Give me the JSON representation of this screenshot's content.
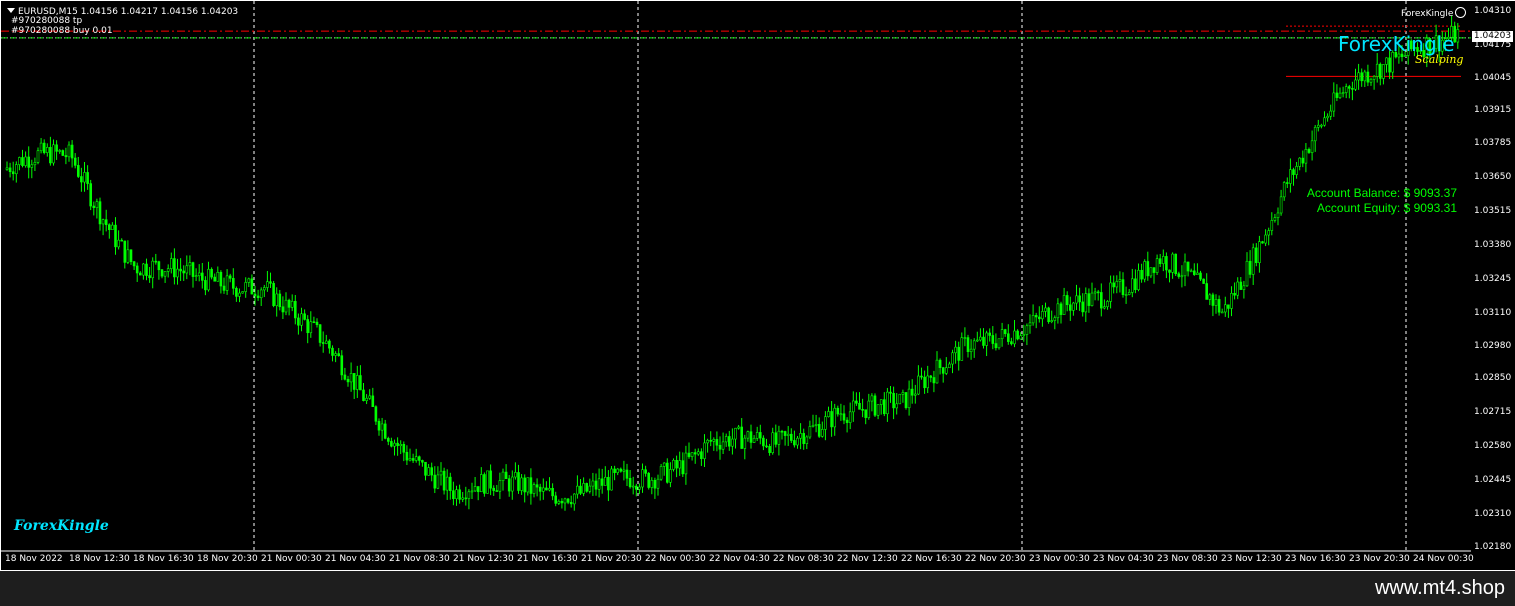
{
  "header": {
    "symbol_line": "EURUSD,M15  1.04156 1.04217 1.04156 1.04203",
    "trade_tp": "#970280088 tp",
    "trade_buy": "#970280088 buy 0.01"
  },
  "indicator": {
    "ea_name": "ForexKingle",
    "brand": "ForexKingle",
    "brand_sub": "Scalping",
    "balance": "Account Balance: $ 9093.37",
    "equity": "Account Equity: $ 9093.31",
    "watermark": "ForexKingle"
  },
  "colors": {
    "background": "#000000",
    "candles": "#00ff00",
    "tp_line": "#ff0000",
    "entry_line": "#00ff00",
    "grid": "#ffffff",
    "brand": "#00e5ff",
    "brand_sub": "#ffff00"
  },
  "price_axis": {
    "labels": [
      "1.04310",
      "1.04175",
      "1.04045",
      "1.03915",
      "1.03785",
      "1.03650",
      "1.03515",
      "1.03380",
      "1.03245",
      "1.03110",
      "1.02980",
      "1.02850",
      "1.02715",
      "1.02580",
      "1.02445",
      "1.02310",
      "1.02180"
    ],
    "current": "1.04203"
  },
  "time_axis": {
    "labels": [
      "18 Nov 2022",
      "18 Nov 12:30",
      "18 Nov 16:30",
      "18 Nov 20:30",
      "21 Nov 00:30",
      "21 Nov 04:30",
      "21 Nov 08:30",
      "21 Nov 12:30",
      "21 Nov 16:30",
      "21 Nov 20:30",
      "22 Nov 00:30",
      "22 Nov 04:30",
      "22 Nov 08:30",
      "22 Nov 12:30",
      "22 Nov 16:30",
      "22 Nov 20:30",
      "23 Nov 00:30",
      "23 Nov 04:30",
      "23 Nov 08:30",
      "23 Nov 12:30",
      "23 Nov 16:30",
      "23 Nov 20:30",
      "24 Nov 00:30"
    ]
  },
  "chart_data": {
    "type": "candlestick",
    "symbol": "EURUSD",
    "timeframe": "M15",
    "ohlc_last": [
      1.04156,
      1.04217,
      1.04156,
      1.04203
    ],
    "ylim": [
      1.0218,
      1.0431
    ],
    "tp_level": 1.0423,
    "entry_level": 1.04203,
    "close_path": [
      {
        "t": "18 Nov 2022",
        "price": 1.0368
      },
      {
        "t": "18 Nov 12:30",
        "price": 1.0373
      },
      {
        "t": "18 Nov 16:30",
        "price": 1.0331
      },
      {
        "t": "18 Nov 20:30",
        "price": 1.0322
      },
      {
        "t": "21 Nov 00:30",
        "price": 1.0325
      },
      {
        "t": "21 Nov 04:30",
        "price": 1.0295
      },
      {
        "t": "21 Nov 08:30",
        "price": 1.0265
      },
      {
        "t": "21 Nov 12:30",
        "price": 1.0237
      },
      {
        "t": "21 Nov 16:30",
        "price": 1.0245
      },
      {
        "t": "21 Nov 20:30",
        "price": 1.0239
      },
      {
        "t": "22 Nov 00:30",
        "price": 1.0244
      },
      {
        "t": "22 Nov 04:30",
        "price": 1.0262
      },
      {
        "t": "22 Nov 08:30",
        "price": 1.0256
      },
      {
        "t": "22 Nov 12:30",
        "price": 1.0275
      },
      {
        "t": "22 Nov 16:30",
        "price": 1.0272
      },
      {
        "t": "22 Nov 20:30",
        "price": 1.0302
      },
      {
        "t": "23 Nov 00:30",
        "price": 1.0304
      },
      {
        "t": "23 Nov 04:30",
        "price": 1.0318
      },
      {
        "t": "23 Nov 08:30",
        "price": 1.0333
      },
      {
        "t": "23 Nov 12:30",
        "price": 1.031
      },
      {
        "t": "23 Nov 16:30",
        "price": 1.0365
      },
      {
        "t": "23 Nov 20:30",
        "price": 1.04
      },
      {
        "t": "24 Nov 00:30",
        "price": 1.04203
      }
    ]
  },
  "footer": {
    "site": "www.mt4.shop"
  }
}
